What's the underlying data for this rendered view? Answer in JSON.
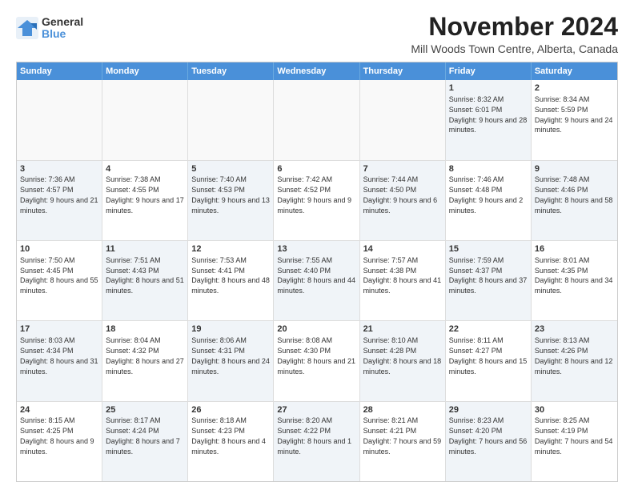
{
  "logo": {
    "general": "General",
    "blue": "Blue"
  },
  "header": {
    "title": "November 2024",
    "subtitle": "Mill Woods Town Centre, Alberta, Canada"
  },
  "days": [
    "Sunday",
    "Monday",
    "Tuesday",
    "Wednesday",
    "Thursday",
    "Friday",
    "Saturday"
  ],
  "rows": [
    [
      {
        "day": "",
        "content": "",
        "empty": true
      },
      {
        "day": "",
        "content": "",
        "empty": true
      },
      {
        "day": "",
        "content": "",
        "empty": true
      },
      {
        "day": "",
        "content": "",
        "empty": true
      },
      {
        "day": "",
        "content": "",
        "empty": true
      },
      {
        "day": "1",
        "content": "Sunrise: 8:32 AM\nSunset: 6:01 PM\nDaylight: 9 hours and 28 minutes.",
        "shaded": true
      },
      {
        "day": "2",
        "content": "Sunrise: 8:34 AM\nSunset: 5:59 PM\nDaylight: 9 hours and 24 minutes.",
        "shaded": false
      }
    ],
    [
      {
        "day": "3",
        "content": "Sunrise: 7:36 AM\nSunset: 4:57 PM\nDaylight: 9 hours and 21 minutes.",
        "shaded": true
      },
      {
        "day": "4",
        "content": "Sunrise: 7:38 AM\nSunset: 4:55 PM\nDaylight: 9 hours and 17 minutes.",
        "shaded": false
      },
      {
        "day": "5",
        "content": "Sunrise: 7:40 AM\nSunset: 4:53 PM\nDaylight: 9 hours and 13 minutes.",
        "shaded": true
      },
      {
        "day": "6",
        "content": "Sunrise: 7:42 AM\nSunset: 4:52 PM\nDaylight: 9 hours and 9 minutes.",
        "shaded": false
      },
      {
        "day": "7",
        "content": "Sunrise: 7:44 AM\nSunset: 4:50 PM\nDaylight: 9 hours and 6 minutes.",
        "shaded": true
      },
      {
        "day": "8",
        "content": "Sunrise: 7:46 AM\nSunset: 4:48 PM\nDaylight: 9 hours and 2 minutes.",
        "shaded": false
      },
      {
        "day": "9",
        "content": "Sunrise: 7:48 AM\nSunset: 4:46 PM\nDaylight: 8 hours and 58 minutes.",
        "shaded": true
      }
    ],
    [
      {
        "day": "10",
        "content": "Sunrise: 7:50 AM\nSunset: 4:45 PM\nDaylight: 8 hours and 55 minutes.",
        "shaded": false
      },
      {
        "day": "11",
        "content": "Sunrise: 7:51 AM\nSunset: 4:43 PM\nDaylight: 8 hours and 51 minutes.",
        "shaded": true
      },
      {
        "day": "12",
        "content": "Sunrise: 7:53 AM\nSunset: 4:41 PM\nDaylight: 8 hours and 48 minutes.",
        "shaded": false
      },
      {
        "day": "13",
        "content": "Sunrise: 7:55 AM\nSunset: 4:40 PM\nDaylight: 8 hours and 44 minutes.",
        "shaded": true
      },
      {
        "day": "14",
        "content": "Sunrise: 7:57 AM\nSunset: 4:38 PM\nDaylight: 8 hours and 41 minutes.",
        "shaded": false
      },
      {
        "day": "15",
        "content": "Sunrise: 7:59 AM\nSunset: 4:37 PM\nDaylight: 8 hours and 37 minutes.",
        "shaded": true
      },
      {
        "day": "16",
        "content": "Sunrise: 8:01 AM\nSunset: 4:35 PM\nDaylight: 8 hours and 34 minutes.",
        "shaded": false
      }
    ],
    [
      {
        "day": "17",
        "content": "Sunrise: 8:03 AM\nSunset: 4:34 PM\nDaylight: 8 hours and 31 minutes.",
        "shaded": true
      },
      {
        "day": "18",
        "content": "Sunrise: 8:04 AM\nSunset: 4:32 PM\nDaylight: 8 hours and 27 minutes.",
        "shaded": false
      },
      {
        "day": "19",
        "content": "Sunrise: 8:06 AM\nSunset: 4:31 PM\nDaylight: 8 hours and 24 minutes.",
        "shaded": true
      },
      {
        "day": "20",
        "content": "Sunrise: 8:08 AM\nSunset: 4:30 PM\nDaylight: 8 hours and 21 minutes.",
        "shaded": false
      },
      {
        "day": "21",
        "content": "Sunrise: 8:10 AM\nSunset: 4:28 PM\nDaylight: 8 hours and 18 minutes.",
        "shaded": true
      },
      {
        "day": "22",
        "content": "Sunrise: 8:11 AM\nSunset: 4:27 PM\nDaylight: 8 hours and 15 minutes.",
        "shaded": false
      },
      {
        "day": "23",
        "content": "Sunrise: 8:13 AM\nSunset: 4:26 PM\nDaylight: 8 hours and 12 minutes.",
        "shaded": true
      }
    ],
    [
      {
        "day": "24",
        "content": "Sunrise: 8:15 AM\nSunset: 4:25 PM\nDaylight: 8 hours and 9 minutes.",
        "shaded": false
      },
      {
        "day": "25",
        "content": "Sunrise: 8:17 AM\nSunset: 4:24 PM\nDaylight: 8 hours and 7 minutes.",
        "shaded": true
      },
      {
        "day": "26",
        "content": "Sunrise: 8:18 AM\nSunset: 4:23 PM\nDaylight: 8 hours and 4 minutes.",
        "shaded": false
      },
      {
        "day": "27",
        "content": "Sunrise: 8:20 AM\nSunset: 4:22 PM\nDaylight: 8 hours and 1 minute.",
        "shaded": true
      },
      {
        "day": "28",
        "content": "Sunrise: 8:21 AM\nSunset: 4:21 PM\nDaylight: 7 hours and 59 minutes.",
        "shaded": false
      },
      {
        "day": "29",
        "content": "Sunrise: 8:23 AM\nSunset: 4:20 PM\nDaylight: 7 hours and 56 minutes.",
        "shaded": true
      },
      {
        "day": "30",
        "content": "Sunrise: 8:25 AM\nSunset: 4:19 PM\nDaylight: 7 hours and 54 minutes.",
        "shaded": false
      }
    ]
  ]
}
